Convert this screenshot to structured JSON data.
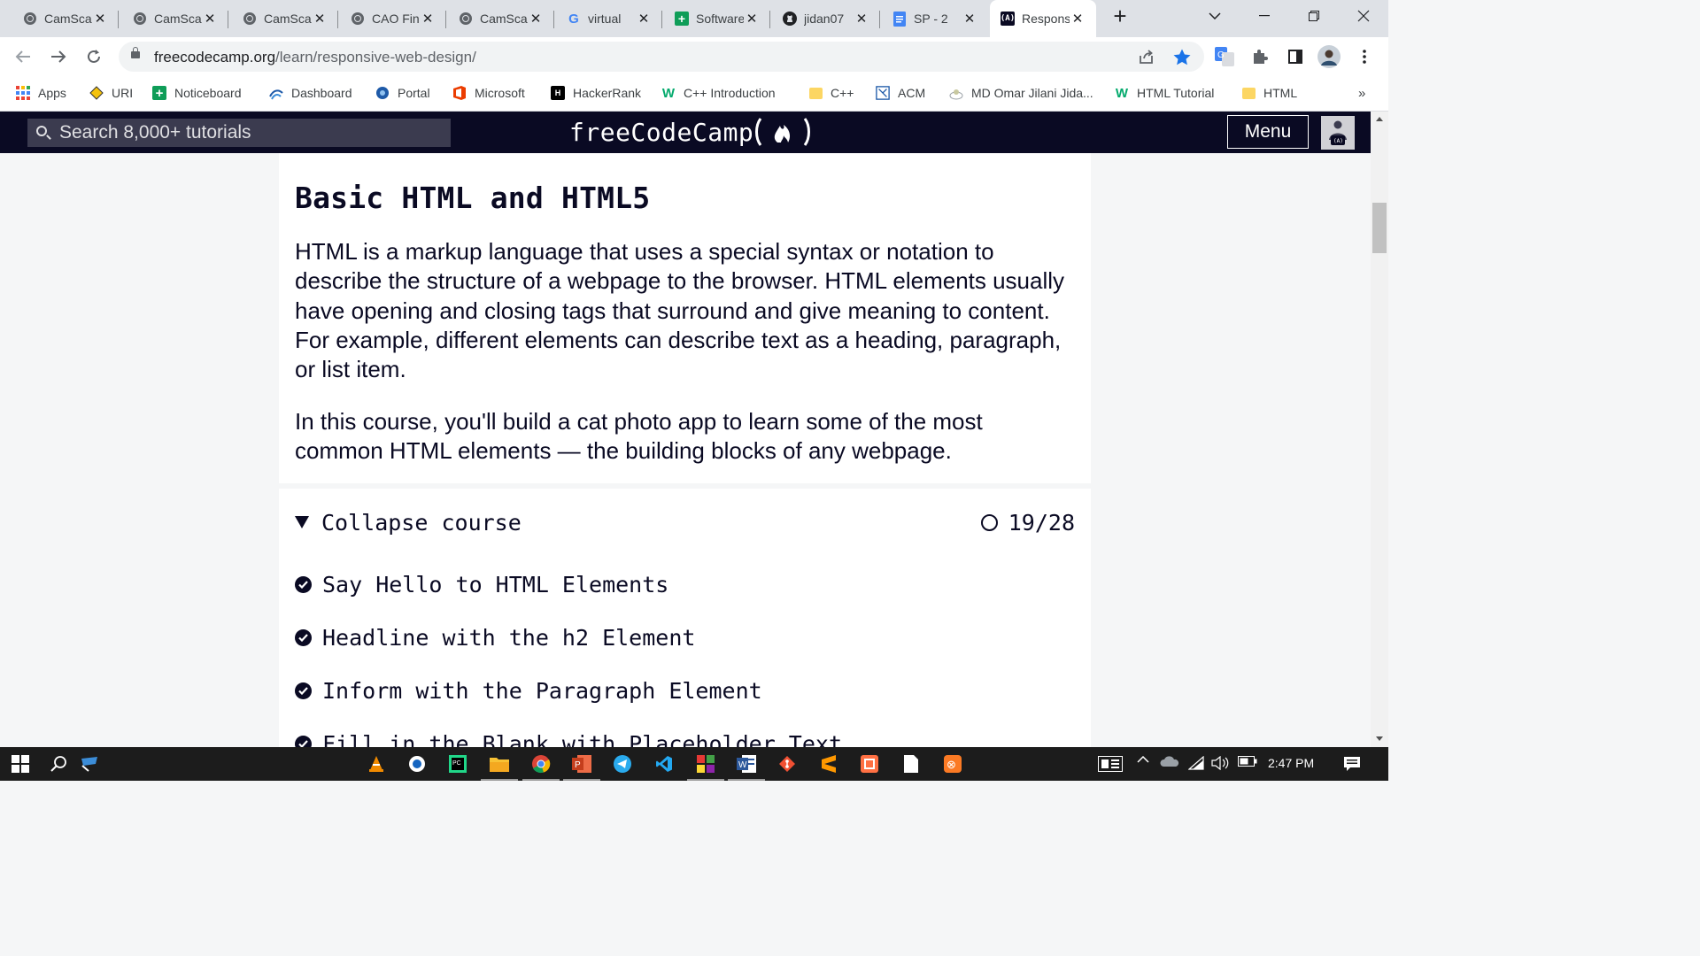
{
  "browser": {
    "tabs": [
      {
        "title": "CamScanner",
        "icon": "globe-icon"
      },
      {
        "title": "CamScanner",
        "icon": "globe-icon"
      },
      {
        "title": "CamScanner",
        "icon": "globe-icon"
      },
      {
        "title": "CAO Final",
        "icon": "globe-icon"
      },
      {
        "title": "CamScanner",
        "icon": "globe-icon"
      },
      {
        "title": "virtual",
        "icon": "google-icon"
      },
      {
        "title": "Software",
        "icon": "sheets-icon"
      },
      {
        "title": "jidan07",
        "icon": "github-icon"
      },
      {
        "title": "SP - 2",
        "icon": "docs-icon"
      },
      {
        "title": "Responsive",
        "icon": "freecodecamp-icon",
        "active": true
      }
    ],
    "new_tab_label": "+",
    "close_label": "✕",
    "url": {
      "domain": "freecodecamp.org",
      "path": "/learn/responsive-web-design/"
    },
    "bookmarks": [
      {
        "label": "Apps",
        "icon": "apps-grid-icon"
      },
      {
        "label": "URI",
        "icon": "uri-icon"
      },
      {
        "label": "Noticeboard",
        "icon": "plus-icon"
      },
      {
        "label": "Dashboard",
        "icon": "dashboard-icon"
      },
      {
        "label": "Portal",
        "icon": "portal-icon"
      },
      {
        "label": "Microsoft",
        "icon": "office-icon"
      },
      {
        "label": "HackerRank",
        "icon": "hackerrank-icon"
      },
      {
        "label": "C++ Introduction",
        "icon": "w3schools-icon"
      },
      {
        "label": "C++",
        "icon": "folder-icon"
      },
      {
        "label": "ACM",
        "icon": "acm-icon"
      },
      {
        "label": "MD Omar Jilani Jida...",
        "icon": "profile-icon"
      },
      {
        "label": "HTML Tutorial",
        "icon": "w3schools-icon"
      },
      {
        "label": "HTML",
        "icon": "folder-icon"
      }
    ],
    "more_bookmarks": "»"
  },
  "fcc": {
    "search_placeholder": "Search 8,000+ tutorials",
    "logo_text": "freeCodeCamp",
    "menu_label": "Menu"
  },
  "main": {
    "block_title": "Basic HTML and HTML5",
    "description_1": "HTML is a markup language that uses a special syntax or notation to describe the structure of a webpage to the browser. HTML elements usually have opening and closing tags that surround and give meaning to content. For example, different elements can describe text as a heading, paragraph, or list item.",
    "description_2": "In this course, you'll build a cat photo app to learn some of the most common HTML elements — the building blocks of any webpage.",
    "toggle_label": "Collapse course",
    "progress_text": "19/28",
    "lessons": [
      "Say Hello to HTML Elements",
      "Headline with the h2 Element",
      "Inform with the Paragraph Element",
      "Fill in the Blank with Placeholder Text"
    ]
  },
  "taskbar": {
    "time": "2:47 PM"
  },
  "colors": {
    "fcc_dark": "#0a0a23",
    "fcc_search": "#3b3b4f",
    "page_bg": "#f5f6f7",
    "bookmark_star": "#1a73e8"
  }
}
